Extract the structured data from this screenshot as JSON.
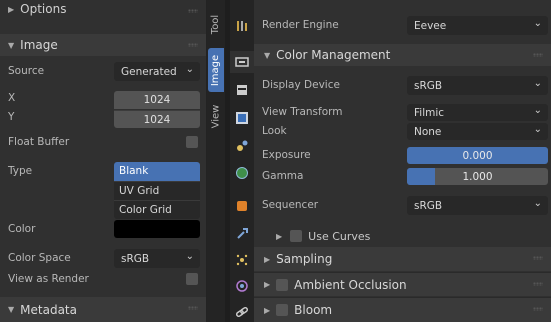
{
  "left_panel": {
    "options_header": "Options",
    "image_header": "Image",
    "source_label": "Source",
    "source_value": "Generated",
    "x_label": "X",
    "x_value": "1024",
    "y_label": "Y",
    "y_value": "1024",
    "float_buffer_label": "Float Buffer",
    "type_label": "Type",
    "type_options": [
      "Blank",
      "UV Grid",
      "Color Grid"
    ],
    "type_selected": "Blank",
    "color_label": "Color",
    "color_value": "#000000",
    "color_space_label": "Color Space",
    "color_space_value": "sRGB",
    "view_as_render_label": "View as Render",
    "metadata_header": "Metadata"
  },
  "vertical_tabs": [
    "Tool",
    "Image",
    "View"
  ],
  "active_vertical_tab": "Image",
  "property_tabs": [
    "tool-icon",
    "render-icon",
    "output-icon",
    "view-layer-icon",
    "scene-icon",
    "world-icon",
    "object-icon",
    "modifier-icon",
    "particles-icon",
    "physics-icon",
    "constraints-icon"
  ],
  "active_property_tab": "render-icon",
  "right_panel": {
    "render_engine_label": "Render Engine",
    "render_engine_value": "Eevee",
    "color_management_header": "Color Management",
    "display_device_label": "Display Device",
    "display_device_value": "sRGB",
    "view_transform_label": "View Transform",
    "view_transform_value": "Filmic",
    "look_label": "Look",
    "look_value": "None",
    "exposure_label": "Exposure",
    "exposure_value": "0.000",
    "gamma_label": "Gamma",
    "gamma_value": "1.000",
    "gamma_fill": 0.2,
    "sequencer_label": "Sequencer",
    "sequencer_value": "sRGB",
    "use_curves_label": "Use Curves",
    "sampling_header": "Sampling",
    "ambient_occlusion_header": "Ambient Occlusion",
    "bloom_header": "Bloom"
  },
  "colors": {
    "accent": "#4772b3",
    "panel": "#303030",
    "header": "#3a3a3a",
    "field": "#545454"
  }
}
